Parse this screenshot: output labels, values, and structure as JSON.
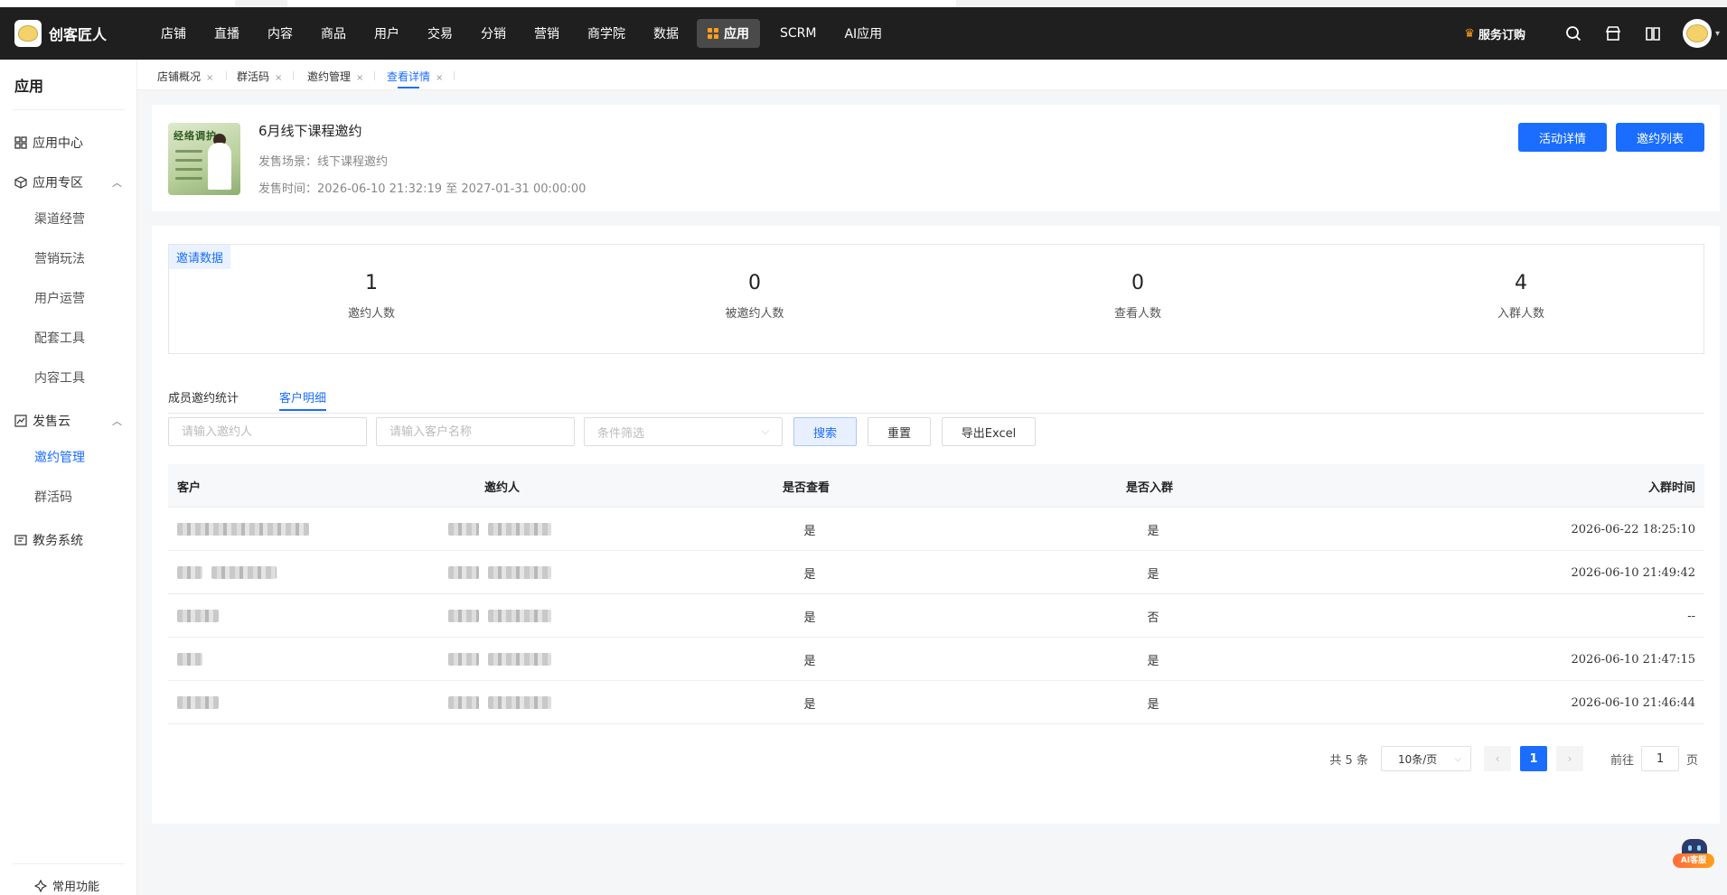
{
  "brand": {
    "name": "创客匠人"
  },
  "nav": {
    "items": [
      "店铺",
      "直播",
      "内容",
      "商品",
      "用户",
      "交易",
      "分销",
      "营销",
      "商学院",
      "数据"
    ],
    "active": "应用",
    "after": [
      "SCRM",
      "AI应用"
    ]
  },
  "topright": {
    "service": "服务订购"
  },
  "sidebar": {
    "title": "应用",
    "app_center": "应用中心",
    "app_zone": "应用专区",
    "zone_items": [
      "渠道经营",
      "营销玩法",
      "用户运营",
      "配套工具",
      "内容工具"
    ],
    "sales_cloud": "发售云",
    "sales_items": [
      "邀约管理",
      "群活码"
    ],
    "edu": "教务系统",
    "common": "常用功能"
  },
  "page_tabs": [
    "店铺概况",
    "群活码",
    "邀约管理",
    "查看详情"
  ],
  "event": {
    "poster_title": "经络调护",
    "title": "6月线下课程邀约",
    "scene": "发售场景：线下课程邀约",
    "time": "发售时间：2026-06-10 21:32:19 至 2027-01-31 00:00:00",
    "btn_detail": "活动详情",
    "btn_list": "邀约列表"
  },
  "stats": {
    "tag": "邀请数据",
    "items": [
      {
        "num": "1",
        "label": "邀约人数"
      },
      {
        "num": "0",
        "label": "被邀约人数"
      },
      {
        "num": "0",
        "label": "查看人数"
      },
      {
        "num": "4",
        "label": "入群人数"
      }
    ]
  },
  "subtabs": {
    "member": "成员邀约统计",
    "customer": "客户明细"
  },
  "filters": {
    "inviter_placeholder": "请输入邀约人",
    "customer_placeholder": "请输入客户名称",
    "condition_placeholder": "条件筛选",
    "search": "搜索",
    "reset": "重置",
    "export": "导出Excel"
  },
  "table": {
    "headers": {
      "customer": "客户",
      "inviter": "邀约人",
      "viewed": "是否查看",
      "joined": "是否入群",
      "time": "入群时间"
    },
    "rows": [
      {
        "viewed": "是",
        "joined": "是",
        "time": "2026-06-22 18:25:10"
      },
      {
        "viewed": "是",
        "joined": "是",
        "time": "2026-06-10 21:49:42"
      },
      {
        "viewed": "是",
        "joined": "否",
        "time": "--"
      },
      {
        "viewed": "是",
        "joined": "是",
        "time": "2026-06-10 21:47:15"
      },
      {
        "viewed": "是",
        "joined": "是",
        "time": "2026-06-10 21:46:44"
      }
    ]
  },
  "pager": {
    "total": "共 5 条",
    "size": "10条/页",
    "current": "1",
    "goto": "前往",
    "goto_value": "1",
    "page_unit": "页"
  },
  "ai": {
    "label": "AI客服"
  }
}
